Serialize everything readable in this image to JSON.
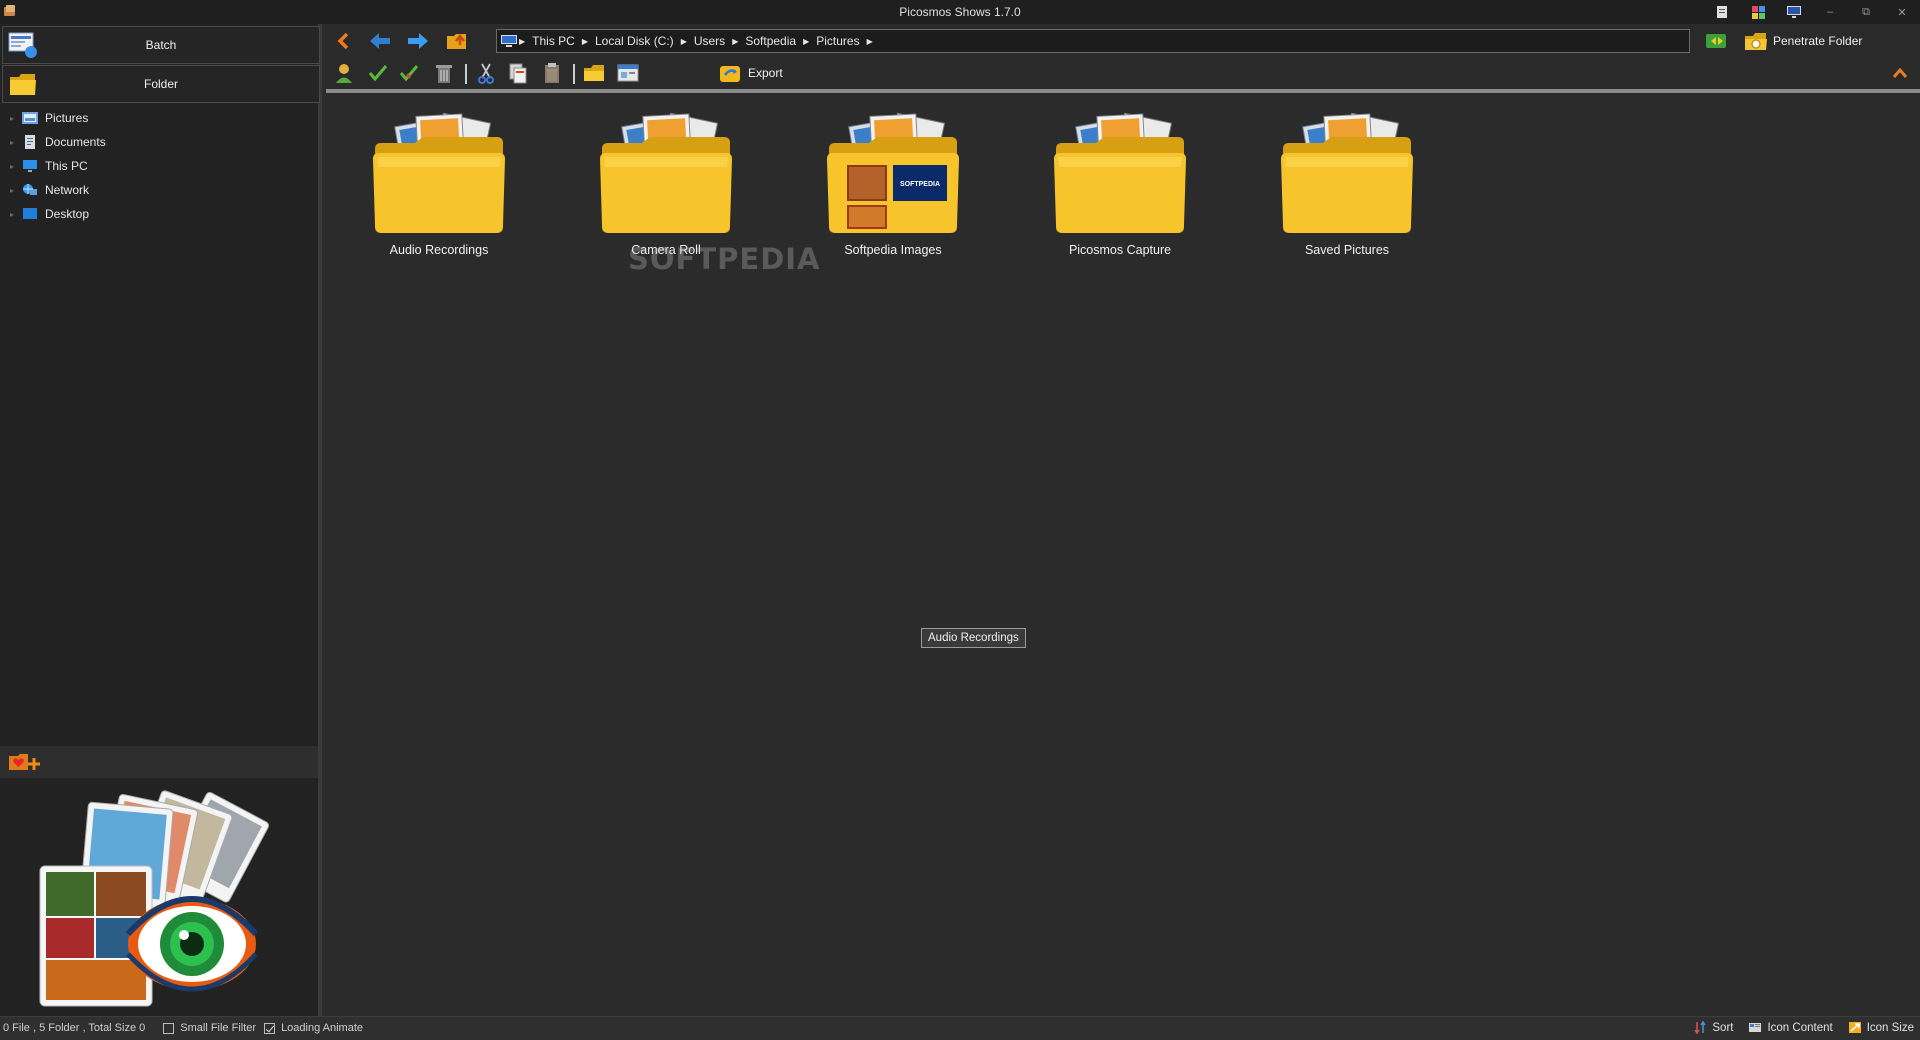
{
  "window": {
    "title": "Picosmos Shows 1.7.0"
  },
  "left_pane": {
    "batch_label": "Batch",
    "folder_label": "Folder",
    "tree": [
      {
        "label": "Pictures",
        "icon": "pictures-folder-icon"
      },
      {
        "label": "Documents",
        "icon": "documents-icon"
      },
      {
        "label": "This PC",
        "icon": "computer-icon"
      },
      {
        "label": "Network",
        "icon": "network-icon"
      },
      {
        "label": "Desktop",
        "icon": "desktop-icon"
      }
    ]
  },
  "address_bar": {
    "crumbs": [
      "This PC",
      "Local Disk (C:)",
      "Users",
      "Softpedia",
      "Pictures"
    ]
  },
  "toolbar": {
    "penetrate_label": "Penetrate Folder",
    "export_label": "Export"
  },
  "folders": [
    {
      "label": "Audio Recordings",
      "has_preview": false
    },
    {
      "label": "Camera Roll",
      "has_preview": false
    },
    {
      "label": "Softpedia Images",
      "has_preview": true,
      "preview_text": "SOFTPEDIA"
    },
    {
      "label": "Picosmos Capture",
      "has_preview": false
    },
    {
      "label": "Saved Pictures",
      "has_preview": false
    }
  ],
  "watermark": "SOFTPEDIA",
  "tooltip": "Audio Recordings",
  "status": {
    "summary": "0 File , 5 Folder , Total Size 0",
    "small_file_filter": {
      "label": "Small File Filter",
      "checked": false
    },
    "loading_animate": {
      "label": "Loading Animate",
      "checked": true
    },
    "sort_label": "Sort",
    "icon_content_label": "Icon Content",
    "icon_size_label": "Icon Size"
  },
  "colors": {
    "background": "#2b2b2b",
    "folder_yellow": "#f7c52b",
    "nav_blue": "#2f8fe0",
    "back_orange": "#f07a1a",
    "check_green": "#4caf3a"
  }
}
